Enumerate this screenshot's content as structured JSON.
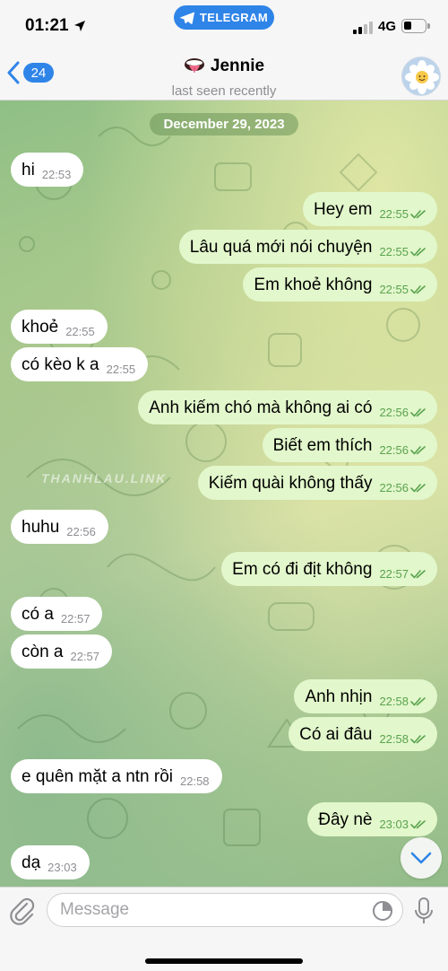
{
  "status_bar": {
    "time": "01:21",
    "app_pill": "TELEGRAM",
    "network": "4G"
  },
  "header": {
    "back_count": "24",
    "contact_name": "Jennie",
    "status": "last seen recently"
  },
  "chat": {
    "date_label": "December 29, 2023",
    "watermark": "THANHLAU.LINK",
    "messages": [
      {
        "dir": "in",
        "text": "hi",
        "time": "22:53"
      },
      {
        "dir": "out",
        "text": "Hey em",
        "time": "22:55"
      },
      {
        "dir": "out",
        "text": "Lâu quá mới nói chuyện",
        "time": "22:55"
      },
      {
        "dir": "out",
        "text": "Em khoẻ không",
        "time": "22:55"
      },
      {
        "dir": "in",
        "text": "khoẻ",
        "time": "22:55"
      },
      {
        "dir": "in",
        "text": "có kèo k a",
        "time": "22:55"
      },
      {
        "dir": "out",
        "text": "Anh kiếm chó mà không ai có",
        "time": "22:56"
      },
      {
        "dir": "out",
        "text": "Biết em thích",
        "time": "22:56"
      },
      {
        "dir": "out",
        "text": "Kiếm quài không thấy",
        "time": "22:56"
      },
      {
        "dir": "in",
        "text": "huhu",
        "time": "22:56"
      },
      {
        "dir": "out",
        "text": "Em có đi địt không",
        "time": "22:57"
      },
      {
        "dir": "in",
        "text": "có a",
        "time": "22:57"
      },
      {
        "dir": "in",
        "text": "còn a",
        "time": "22:57"
      },
      {
        "dir": "out",
        "text": "Anh nhịn",
        "time": "22:58"
      },
      {
        "dir": "out",
        "text": "Có ai đâu",
        "time": "22:58"
      },
      {
        "dir": "in",
        "text": "e quên mặt a ntn rồi",
        "time": "22:58"
      },
      {
        "dir": "out",
        "text": "Đây nè",
        "time": "23:03"
      },
      {
        "dir": "in",
        "text": "dạ",
        "time": "23:03"
      }
    ]
  },
  "input": {
    "placeholder": "Message"
  },
  "colors": {
    "accent": "#2f84e8",
    "outgoing_bubble": "#e2f7cb",
    "incoming_bubble": "#ffffff",
    "read_ticks": "#5aa34f"
  },
  "icons": {
    "back": "chevron-left-icon",
    "attach": "paperclip-icon",
    "sticker": "sticker-icon",
    "mic": "microphone-icon",
    "scroll": "chevron-down-icon"
  }
}
